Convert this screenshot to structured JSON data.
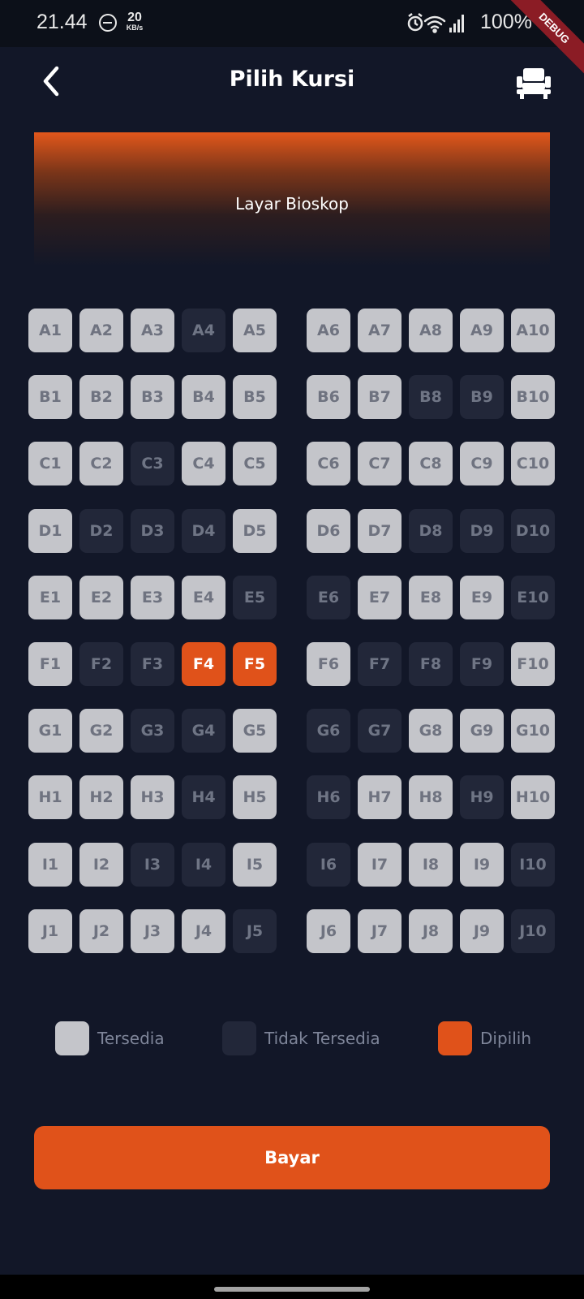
{
  "status_bar": {
    "time": "21.44",
    "net_speed": "20",
    "net_unit": "KB/s",
    "battery": "100%",
    "debug_label": "DEBUG"
  },
  "header": {
    "title": "Pilih Kursi",
    "back_icon": "back-arrow-icon",
    "seat_icon": "seat-icon"
  },
  "screen": {
    "label": "Layar Bioskop"
  },
  "seats": {
    "rows": [
      {
        "row": "A",
        "states": [
          "available",
          "available",
          "available",
          "unavailable",
          "available",
          "available",
          "available",
          "available",
          "available",
          "available"
        ]
      },
      {
        "row": "B",
        "states": [
          "available",
          "available",
          "available",
          "available",
          "available",
          "available",
          "available",
          "unavailable",
          "unavailable",
          "available"
        ]
      },
      {
        "row": "C",
        "states": [
          "available",
          "available",
          "unavailable",
          "available",
          "available",
          "available",
          "available",
          "available",
          "available",
          "available"
        ]
      },
      {
        "row": "D",
        "states": [
          "available",
          "unavailable",
          "unavailable",
          "unavailable",
          "available",
          "available",
          "available",
          "unavailable",
          "unavailable",
          "unavailable"
        ]
      },
      {
        "row": "E",
        "states": [
          "available",
          "available",
          "available",
          "available",
          "unavailable",
          "unavailable",
          "available",
          "available",
          "available",
          "unavailable"
        ]
      },
      {
        "row": "F",
        "states": [
          "available",
          "unavailable",
          "unavailable",
          "selected",
          "selected",
          "available",
          "unavailable",
          "unavailable",
          "unavailable",
          "available"
        ]
      },
      {
        "row": "G",
        "states": [
          "available",
          "available",
          "unavailable",
          "unavailable",
          "available",
          "unavailable",
          "unavailable",
          "available",
          "available",
          "available"
        ]
      },
      {
        "row": "H",
        "states": [
          "available",
          "available",
          "available",
          "unavailable",
          "available",
          "unavailable",
          "available",
          "available",
          "unavailable",
          "available"
        ]
      },
      {
        "row": "I",
        "states": [
          "available",
          "available",
          "unavailable",
          "unavailable",
          "available",
          "unavailable",
          "available",
          "available",
          "available",
          "unavailable"
        ]
      },
      {
        "row": "J",
        "states": [
          "available",
          "available",
          "available",
          "available",
          "unavailable",
          "available",
          "available",
          "available",
          "available",
          "unavailable"
        ]
      }
    ]
  },
  "legend": {
    "available": "Tersedia",
    "unavailable": "Tidak Tersedia",
    "selected": "Dipilih"
  },
  "colors": {
    "background": "#121728",
    "available": "#c4c5ca",
    "unavailable": "#222739",
    "selected": "#e0521a",
    "accent": "#e0521a"
  },
  "pay_button": {
    "label": "Bayar"
  }
}
